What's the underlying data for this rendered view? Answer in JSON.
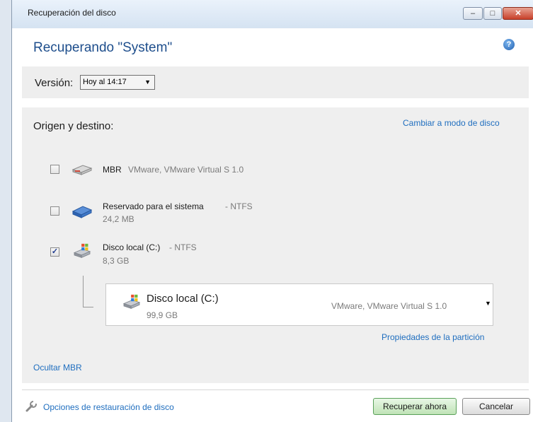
{
  "window": {
    "title": "Recuperación del disco",
    "controls": {
      "minimize": "‒",
      "maximize": "□",
      "close": "✕"
    }
  },
  "header": {
    "title": "Recuperando \"System\""
  },
  "version": {
    "label": "Versión:",
    "selected": "Hoy al 14:17"
  },
  "source": {
    "title": "Origen y destino:",
    "switch_link": "Cambiar a modo de disco",
    "items": [
      {
        "name": "MBR",
        "meta": "VMware, VMware Virtual S 1.0",
        "size": "",
        "checked": false
      },
      {
        "name": "Reservado para el sistema",
        "meta": "- NTFS",
        "size": "24,2 MB",
        "checked": false
      },
      {
        "name": "Disco local (C:)",
        "meta": "- NTFS",
        "size": "8,3 GB",
        "checked": true
      }
    ],
    "target": {
      "name": "Disco local (C:)",
      "size": "99,9 GB",
      "device": "VMware, VMware Virtual S 1.0"
    },
    "properties_link": "Propiedades de la partición",
    "hide_mbr_link": "Ocultar MBR"
  },
  "footer": {
    "options_link": "Opciones de restauración de disco",
    "recover_button": "Recuperar ahora",
    "cancel_button": "Cancelar"
  }
}
